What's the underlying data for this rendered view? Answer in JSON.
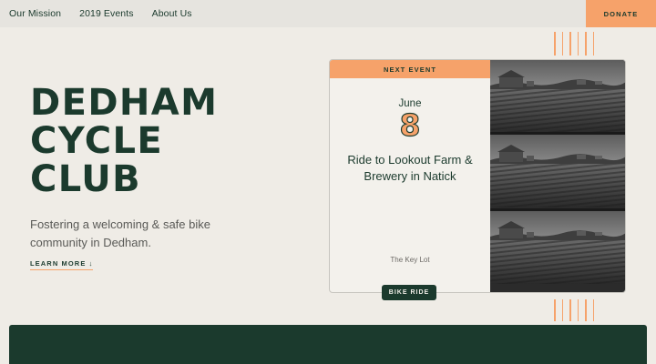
{
  "nav": {
    "links": [
      "Our Mission",
      "2019 Events",
      "About Us"
    ],
    "donate_label": "DONATE"
  },
  "hero": {
    "title_lines": [
      "DEDHAM",
      "CYCLE",
      "CLUB"
    ],
    "tagline": "Fostering a welcoming & safe bike community in Dedham.",
    "learn_more": "LEARN MORE ↓"
  },
  "event": {
    "header": "NEXT EVENT",
    "month": "June",
    "day": "8",
    "title": "Ride to Lookout Farm & Brewery in Natick",
    "location": "The Key Lot",
    "tag": "BIKE RIDE"
  },
  "colors": {
    "accent": "#f6a26a",
    "primary": "#1b3a2d",
    "background": "#efece6"
  }
}
